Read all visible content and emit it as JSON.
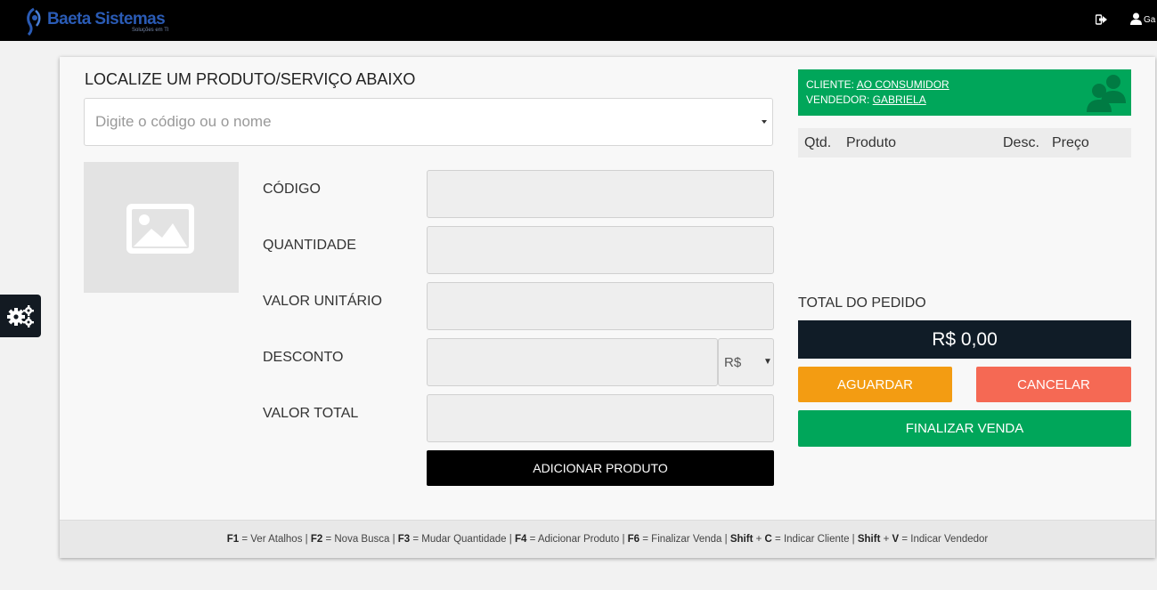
{
  "brand": {
    "name": "Baeta Sistemas",
    "tagline": "Soluções em TI"
  },
  "topbar": {
    "user_name": "Ga"
  },
  "search": {
    "title": "LOCALIZE UM PRODUTO/SERVIÇO ABAIXO",
    "placeholder": "Digite o código ou o nome"
  },
  "fields": {
    "codigo": {
      "label": "CÓDIGO",
      "value": ""
    },
    "quantidade": {
      "label": "QUANTIDADE",
      "value": ""
    },
    "valor_unitario": {
      "label": "VALOR UNITÁRIO",
      "value": ""
    },
    "desconto": {
      "label": "DESCONTO",
      "value": "",
      "currency": "R$"
    },
    "valor_total": {
      "label": "VALOR TOTAL",
      "value": ""
    }
  },
  "add_button": "ADICIONAR PRODUTO",
  "client": {
    "cliente_label": "CLIENTE:",
    "cliente_value": "AO CONSUMIDOR",
    "vendedor_label": "VENDEDOR:",
    "vendedor_value": "GABRIELA"
  },
  "items_table": {
    "columns": [
      "Qtd.",
      "Produto",
      "Desc.",
      "Preço"
    ],
    "rows": []
  },
  "total": {
    "label": "TOTAL DO PEDIDO",
    "value": "R$ 0,00"
  },
  "actions": {
    "wait": "AGUARDAR",
    "cancel": "CANCELAR",
    "finish": "FINALIZAR VENDA"
  },
  "shortcuts": [
    {
      "key": "F1",
      "desc": " = Ver Atalhos"
    },
    {
      "key": "F2",
      "desc": " = Nova Busca"
    },
    {
      "key": "F3",
      "desc": " = Mudar Quantidade"
    },
    {
      "key": "F4",
      "desc": " = Adicionar Produto"
    },
    {
      "key": "F6",
      "desc": " = Finalizar Venda"
    },
    {
      "key": "Shift",
      "desc": " + ",
      "key2": "C",
      "desc2": " = Indicar Cliente"
    },
    {
      "key": "Shift",
      "desc": " + ",
      "key2": "V",
      "desc2": " = Indicar Vendedor"
    }
  ],
  "colors": {
    "green": "#00a65a",
    "orange": "#f39c12",
    "red": "#f56954",
    "navy": "#101c27"
  }
}
